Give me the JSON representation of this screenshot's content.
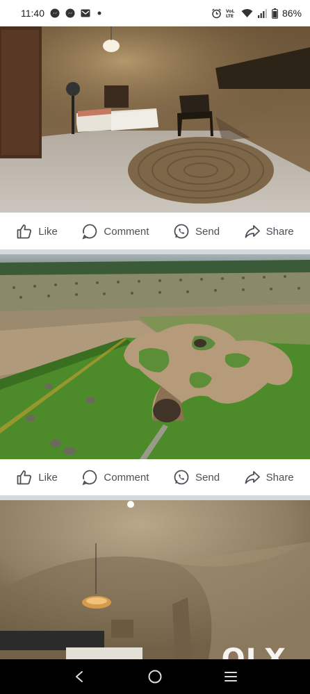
{
  "status_bar": {
    "time": "11:40",
    "battery_percent": "86%",
    "left_icons": [
      "messenger-icon",
      "messenger-icon",
      "email-icon",
      "dot-icon"
    ],
    "right_icons": [
      "alarm-icon",
      "volte-icon",
      "wifi-icon",
      "signal-icon",
      "battery-icon"
    ]
  },
  "posts": [
    {
      "photo_subject": "bedroom",
      "actions": {
        "like": "Like",
        "comment": "Comment",
        "send": "Send",
        "share": "Share"
      }
    },
    {
      "photo_subject": "aerial",
      "actions": {
        "like": "Like",
        "comment": "Comment",
        "send": "Send",
        "share": "Share"
      }
    },
    {
      "photo_subject": "interior"
    }
  ],
  "watermark": {
    "brand": "OLX"
  },
  "nav_bar": {
    "buttons": [
      "back-icon",
      "home-icon",
      "recents-icon"
    ]
  },
  "colors": {
    "action_text": "#4b4f56",
    "divider": "#d6d9de",
    "nav_bg": "#000000"
  }
}
